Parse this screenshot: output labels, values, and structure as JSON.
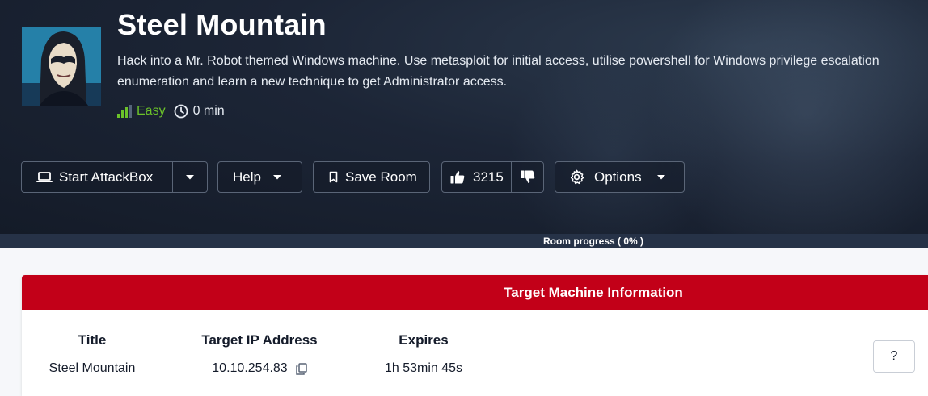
{
  "room": {
    "title": "Steel Mountain",
    "description": "Hack into a Mr. Robot themed Windows machine. Use metasploit for initial access, utilise powershell for Windows privilege escalation enumeration and learn a new technique to get Administrator access.",
    "difficulty": "Easy",
    "duration": "0 min"
  },
  "toolbar": {
    "start_attackbox_label": "Start AttackBox",
    "help_label": "Help",
    "save_room_label": "Save Room",
    "likes_count": "3215",
    "options_label": "Options"
  },
  "progress": {
    "label": "Room progress ( 0% )",
    "value": 0
  },
  "target_machine": {
    "header": "Target Machine Information",
    "columns": [
      "Title",
      "Target IP Address",
      "Expires"
    ],
    "title_value": "Steel Mountain",
    "ip_value": "10.10.254.83",
    "expires_value": "1h 53min 45s",
    "help_button": "?"
  },
  "colors": {
    "hero_bg": "#1c2536",
    "difficulty_green": "#6bc22a",
    "panel_header_red": "#c20018"
  },
  "icons": [
    "laptop-icon",
    "chevron-down-icon",
    "bookmark-icon",
    "thumbs-up-icon",
    "thumbs-down-icon",
    "gear-icon",
    "clock-icon",
    "copy-icon",
    "difficulty-bars-icon"
  ]
}
